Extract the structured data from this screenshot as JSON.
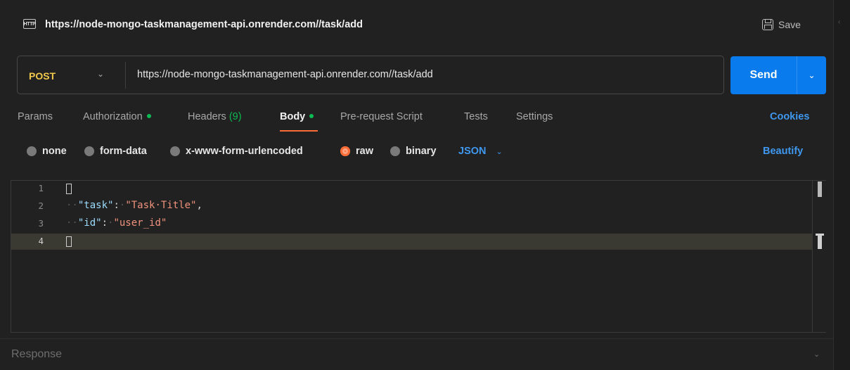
{
  "header": {
    "icon_text": "HTTP",
    "title": "https://node-mongo-taskmanagement-api.onrender.com//task/add",
    "save_label": "Save"
  },
  "request": {
    "method": "POST",
    "url": "https://node-mongo-taskmanagement-api.onrender.com//task/add",
    "send_label": "Send"
  },
  "tabs": {
    "params": "Params",
    "authorization": "Authorization",
    "headers": "Headers",
    "headers_count": "(9)",
    "body": "Body",
    "prerequest": "Pre-request Script",
    "tests": "Tests",
    "settings": "Settings",
    "cookies": "Cookies"
  },
  "body_options": {
    "none": "none",
    "form_data": "form-data",
    "urlencoded": "x-www-form-urlencoded",
    "raw": "raw",
    "binary": "binary",
    "format": "JSON",
    "beautify": "Beautify"
  },
  "editor": {
    "line_numbers": [
      "1",
      "2",
      "3",
      "4"
    ],
    "line2_key": "\"task\"",
    "line2_value": "\"Task·Title\"",
    "line3_key": "\"id\"",
    "line3_value": "\"user_id\""
  },
  "response": {
    "label": "Response"
  },
  "colors": {
    "accent_orange": "#ff6c37",
    "send_blue": "#097bed",
    "method_yellow": "#f2c94c",
    "link_blue": "#3f98ef",
    "status_green": "#0cbb52"
  }
}
